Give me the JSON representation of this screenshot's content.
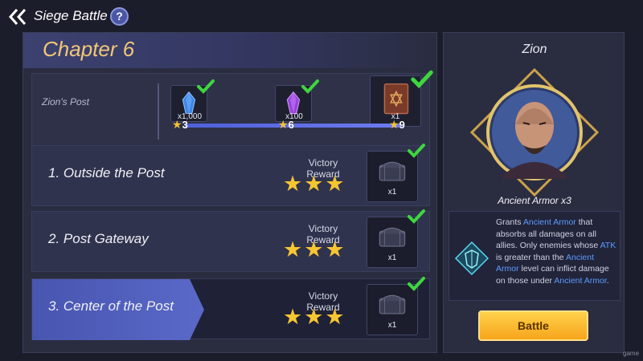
{
  "header": {
    "title": "Siege Battle",
    "help_icon": "?"
  },
  "chapter": {
    "title": "Chapter 6"
  },
  "post": {
    "label": "Zion's Post",
    "rewards": [
      {
        "icon": "blue-crystal-icon",
        "qty": "x1,000",
        "stars": "3",
        "claimed": true
      },
      {
        "icon": "purple-crystal-icon",
        "qty": "x100",
        "stars": "6",
        "claimed": true
      },
      {
        "icon": "spellbook-icon",
        "qty": "x1",
        "stars": "9",
        "claimed": true
      }
    ]
  },
  "stages": [
    {
      "name": "1. Outside the Post",
      "reward_label": "Victory Reward",
      "stars": 3,
      "chest_qty": "x1",
      "claimed": true
    },
    {
      "name": "2. Post Gateway",
      "reward_label": "Victory Reward",
      "stars": 3,
      "chest_qty": "x1",
      "claimed": true
    },
    {
      "name": "3. Center of the Post",
      "reward_label": "Victory Reward",
      "stars": 3,
      "chest_qty": "x1",
      "claimed": true,
      "selected": true
    }
  ],
  "boss": {
    "name": "Zion",
    "buff_title": "Ancient Armor x3",
    "desc": {
      "p1": "Grants ",
      "h1": "Ancient Armor",
      "p2": " that absorbs all damages on all allies. Only enemies whose ",
      "h2": "ATK",
      "p3": " is greater than the ",
      "h3": "Ancient Armor",
      "p4": " level can inflict damage on those under ",
      "h4": "Ancient Armor",
      "p5": "."
    }
  },
  "battle_button": "Battle",
  "watermark": "game",
  "colors": {
    "accent_blue": "#4856b0",
    "gold": "#f2c776",
    "star": "#f6c531",
    "check": "#3ed63e",
    "highlight_text": "#5b9cff"
  }
}
